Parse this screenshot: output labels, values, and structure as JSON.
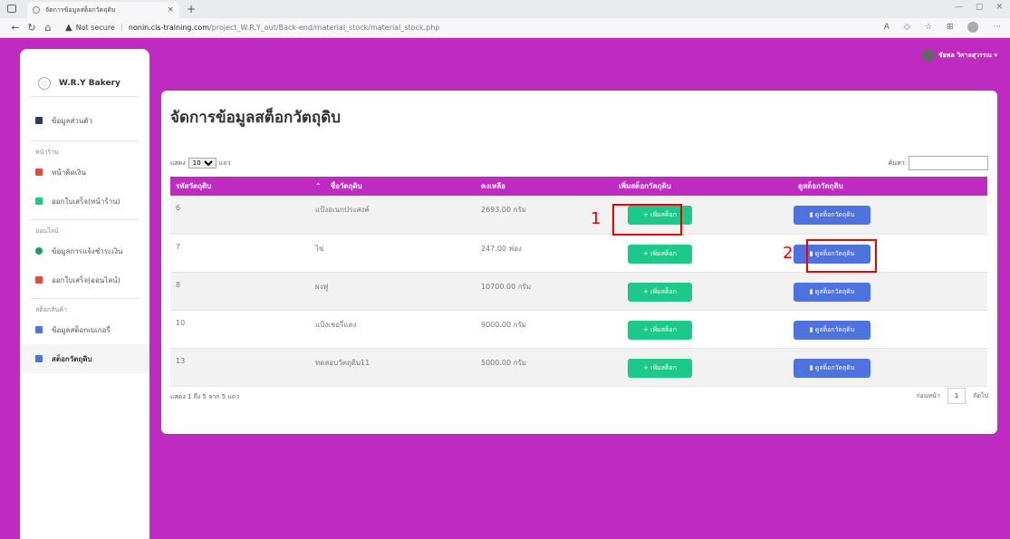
{
  "browser": {
    "tab_title": "จัดการข้อมูลสต็อกวัตถุดิบ",
    "tab_close": "×",
    "new_tab": "+",
    "not_secure": "Not secure",
    "url_host": "nonin.cis-training.com",
    "url_path": "/project_W.R.Y_out/Back-end/material_stock/material_stock.php"
  },
  "sidebar": {
    "brand": "W.R.Y Bakery",
    "profile": "ข้อมูลส่วนตัว",
    "sections": [
      {
        "title": "หน้าร้าน",
        "items": [
          "หน้าคิดเงิน",
          "ออกใบเสร็จ(หน้าร้าน)"
        ]
      },
      {
        "title": "ออนไลน์",
        "items": [
          "ข้อมูลการแจ้งชำระเงิน",
          "ออกใบเสร็จ(ออนไลน์)"
        ]
      },
      {
        "title": "สต็อกสินค้า",
        "items": [
          "ข้อมูลสต็อกเบเกอรี่",
          "สต็อกวัตถุดิบ"
        ]
      }
    ],
    "colors": {
      "profile": "#2c3e50",
      "red": "#e74a3b",
      "green": "#1cc88a",
      "blue": "#4e73df",
      "greenDark": "#1a9b6b"
    }
  },
  "user": {
    "name": "ชัยพล วิศาลสุวรรณ ▾"
  },
  "main": {
    "title": "จัดการข้อมูลสต็อกวัตถุดิบ",
    "length_prefix": "แสดง",
    "length_value": "10",
    "length_suffix": "แถว",
    "search_label": "ค้นหา:",
    "columns": [
      "รหัสวัตถุดิบ",
      "ชื่อวัตถุดิบ",
      "คงเหลือ",
      "เพิ่มสต็อกวัตถุดิบ",
      "ดูสต็อกวัตถุดิบ"
    ],
    "sort_indicator": "⌃",
    "add_button": "+ เพิ่มสต็อก",
    "view_button": "ดูสต็อกวัตถุดิบ",
    "rows": [
      {
        "id": "6",
        "name": "แป้งอเนกประสงค์",
        "qty": "2693.00 กรัม"
      },
      {
        "id": "7",
        "name": "ไข่",
        "qty": "247.00 ฟอง"
      },
      {
        "id": "8",
        "name": "ผงฟู",
        "qty": "10700.00 กรัม"
      },
      {
        "id": "10",
        "name": "แป้งเชอรี่แดง",
        "qty": "9000.00 กรัม"
      },
      {
        "id": "13",
        "name": "ทดสอบวัตถุดิบ11",
        "qty": "5000.00 กรัม"
      }
    ],
    "info": "แสดง 1 ถึง 5 จาก 5 แถว",
    "prev": "ก่อนหน้า",
    "page": "1",
    "next": "ถัดไป"
  },
  "annotations": [
    "1",
    "2"
  ]
}
